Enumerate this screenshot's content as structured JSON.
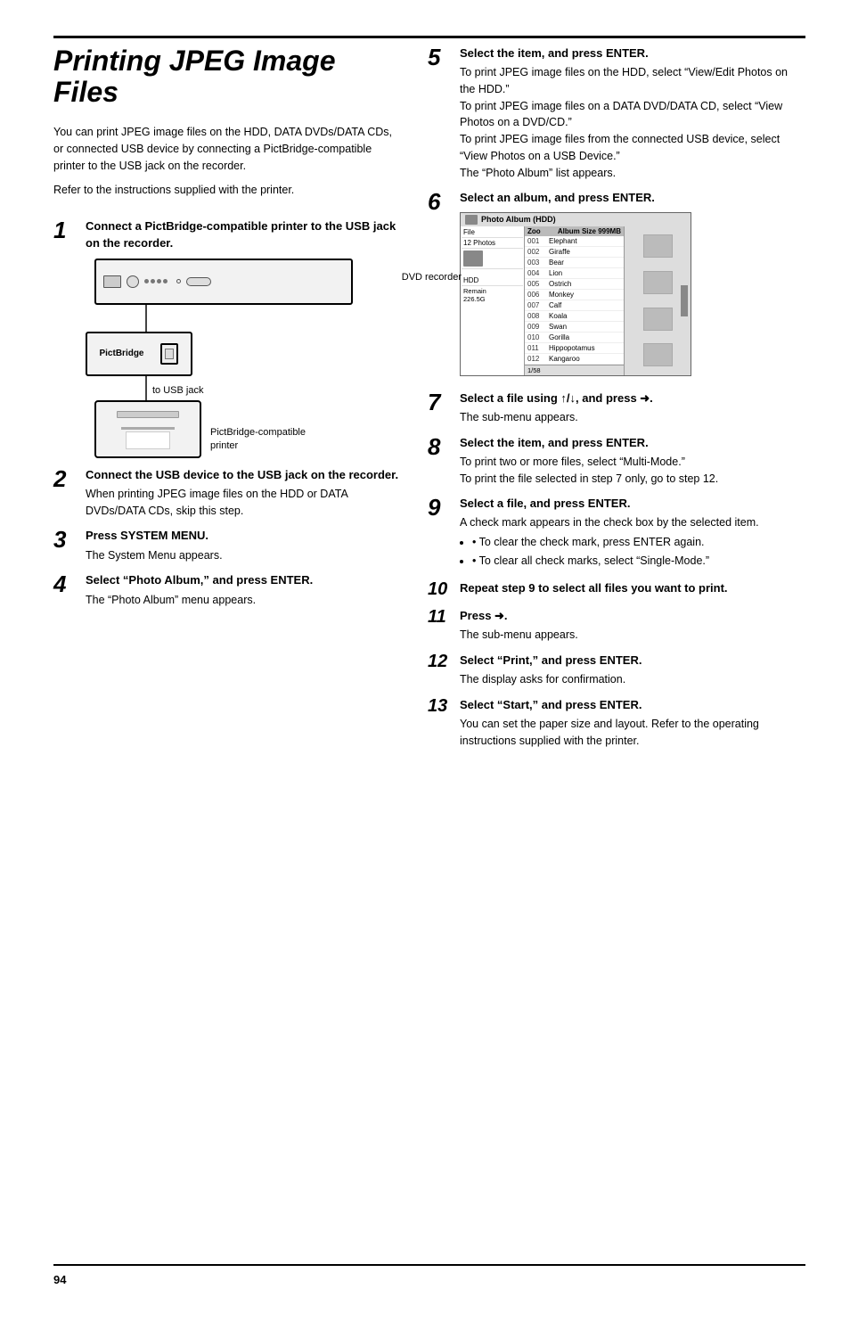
{
  "page": {
    "number": "94",
    "top_rule": true,
    "bottom_rule": true
  },
  "title": "Printing JPEG Image Files",
  "intro": [
    "You can print JPEG image files on the HDD, DATA DVDs/DATA CDs, or connected USB device by connecting a PictBridge-compatible printer to the USB jack on the recorder.",
    "Refer to the instructions supplied with the printer."
  ],
  "steps": [
    {
      "num": "1",
      "size": "large",
      "title": "Connect a PictBridge-compatible printer to the USB jack on the recorder.",
      "body": [],
      "has_diagram": true
    },
    {
      "num": "2",
      "size": "large",
      "title": "Connect the USB device to the USB jack on the recorder.",
      "body": [
        "When printing JPEG image files on the HDD or DATA DVDs/DATA CDs, skip this step."
      ]
    },
    {
      "num": "3",
      "size": "large",
      "title": "Press SYSTEM MENU.",
      "body": [
        "The System Menu appears."
      ]
    },
    {
      "num": "4",
      "size": "large",
      "title": "Select “Photo Album,” and press ENTER.",
      "body": [
        "The “Photo Album” menu appears."
      ]
    }
  ],
  "right_steps": [
    {
      "num": "5",
      "size": "large",
      "title": "Select the item, and press ENTER.",
      "body": [
        "To print JPEG image files on the HDD, select “View/Edit Photos on the HDD.”",
        "To print JPEG image files on a DATA DVD/DATA CD, select “View Photos on a DVD/CD.”",
        "To print JPEG image files from the connected USB device, select “View Photos on a USB Device.”",
        "The “Photo Album” list appears."
      ]
    },
    {
      "num": "6",
      "size": "large",
      "title": "Select an album, and press ENTER.",
      "has_screenshot": true,
      "screenshot": {
        "title": "Photo Album (HDD)",
        "sidebar": {
          "rows": [
            {
              "label": "File",
              "value": ""
            },
            {
              "label": "12 Photos",
              "value": ""
            },
            {
              "label": "",
              "value": ""
            },
            {
              "label": "HDD",
              "value": ""
            },
            {
              "label": "Remain",
              "value": ""
            },
            {
              "label": "226.5G",
              "value": ""
            }
          ]
        },
        "album_name": "Zoo",
        "album_size": "Album Size 999MB",
        "list": [
          {
            "num": "001",
            "name": "Elephant"
          },
          {
            "num": "002",
            "name": "Giraffe"
          },
          {
            "num": "003",
            "name": "Bear"
          },
          {
            "num": "004",
            "name": "Lion"
          },
          {
            "num": "005",
            "name": "Ostrich"
          },
          {
            "num": "006",
            "name": "Monkey"
          },
          {
            "num": "007",
            "name": "Calf"
          },
          {
            "num": "008",
            "name": "Koala"
          },
          {
            "num": "009",
            "name": "Swan"
          },
          {
            "num": "010",
            "name": "Gorilla"
          },
          {
            "num": "011",
            "name": "Hippopotamus"
          },
          {
            "num": "012",
            "name": "Kangaroo"
          }
        ],
        "page_indicator": "1/58"
      }
    },
    {
      "num": "7",
      "size": "large",
      "title": "Select a file using ↑/↓, and press ➜.",
      "body": [
        "The sub-menu appears."
      ]
    },
    {
      "num": "8",
      "size": "large",
      "title": "Select the item, and press ENTER.",
      "body": [
        "To print two or more files, select “Multi-Mode.”",
        "To print the file selected in step 7 only, go to step 12."
      ]
    },
    {
      "num": "9",
      "size": "large",
      "title": "Select a file, and press ENTER.",
      "body": [
        "A check mark appears in the check box by the selected item.",
        "• To clear the check mark, press ENTER again.",
        "• To clear all check marks, select “Single-Mode.”"
      ]
    },
    {
      "num": "10",
      "size": "small",
      "title": "Repeat step 9 to select all files you want to print.",
      "body": []
    },
    {
      "num": "11",
      "size": "small",
      "title": "Press ➜.",
      "body": [
        "The sub-menu appears."
      ]
    },
    {
      "num": "12",
      "size": "small",
      "title": "Select “Print,” and press ENTER.",
      "body": [
        "The display asks for confirmation."
      ]
    },
    {
      "num": "13",
      "size": "small",
      "title": "Select “Start,” and press ENTER.",
      "body": [
        "You can set the paper size and layout. Refer to the operating instructions supplied with the printer."
      ]
    }
  ],
  "diagram": {
    "dvd_recorder_label": "DVD recorder",
    "pictbridge_label": "PictBridge",
    "usb_jack_label": "to USB jack",
    "printer_label": "PictBridge-compatible\nprinter"
  }
}
